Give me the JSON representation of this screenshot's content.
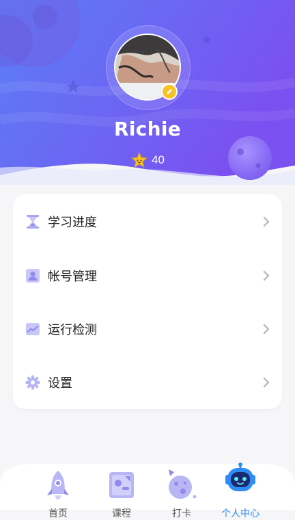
{
  "colors": {
    "header_gradient_start": "#5b7cf6",
    "header_gradient_end": "#7a52f0",
    "icon_purple": "#a6a4f2",
    "badge_yellow": "#f7c324",
    "chevron": "#b9bbc6",
    "tab_active": "#2f8cf5"
  },
  "profile": {
    "username": "Richie",
    "stars": "40",
    "edit_icon": "pencil-icon",
    "star_icon": "star-icon"
  },
  "menu": {
    "items": [
      {
        "label": "学习进度",
        "icon": "hourglass-icon"
      },
      {
        "label": "帐号管理",
        "icon": "person-card-icon"
      },
      {
        "label": "运行检测",
        "icon": "trend-chart-icon"
      },
      {
        "label": "设置",
        "icon": "gear-icon"
      }
    ]
  },
  "tabbar": {
    "tabs": [
      {
        "label": "首页",
        "icon": "rocket-icon"
      },
      {
        "label": "课程",
        "icon": "course-board-icon"
      },
      {
        "label": "打卡",
        "icon": "moon-planet-icon"
      },
      {
        "label": "个人中心",
        "icon": "robot-icon",
        "active": true
      }
    ]
  }
}
